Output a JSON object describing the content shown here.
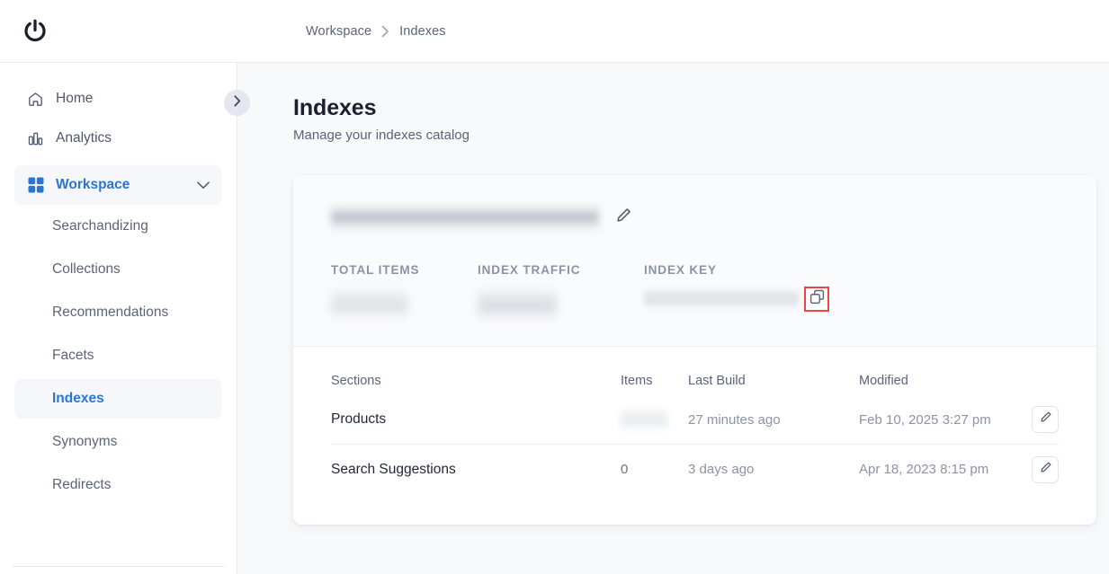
{
  "brand": {
    "logo_icon": "power-logo-icon"
  },
  "breadcrumb": {
    "items": [
      "Workspace",
      "Indexes"
    ],
    "separator": "›"
  },
  "sidebar": {
    "collapse_toggle_icon": "chevron-right-icon",
    "items": [
      {
        "label": "Home",
        "icon": "home-icon",
        "active": false
      },
      {
        "label": "Analytics",
        "icon": "bar-chart-icon",
        "active": false
      },
      {
        "label": "Workspace",
        "icon": "grid-icon",
        "active": true,
        "expanded": true,
        "chevron": "chevron-down-icon"
      }
    ],
    "sub_items": [
      {
        "label": "Searchandizing",
        "active": false
      },
      {
        "label": "Collections",
        "active": false
      },
      {
        "label": "Recommendations",
        "active": false
      },
      {
        "label": "Facets",
        "active": false
      },
      {
        "label": "Indexes",
        "active": true
      },
      {
        "label": "Synonyms",
        "active": false
      },
      {
        "label": "Redirects",
        "active": false
      }
    ]
  },
  "page": {
    "title": "Indexes",
    "subtitle": "Manage your indexes catalog"
  },
  "index_card": {
    "name_redacted": true,
    "name_value": "",
    "edit_name_icon": "pencil-icon",
    "stats": [
      {
        "key": "total_items",
        "label": "TOTAL ITEMS",
        "value": "",
        "redacted": true
      },
      {
        "key": "index_traffic",
        "label": "INDEX TRAFFIC",
        "value": "",
        "redacted": true
      },
      {
        "key": "index_key",
        "label": "INDEX KEY",
        "value": "",
        "redacted": true
      }
    ],
    "copy_key_icon": "copy-icon",
    "copy_highlight_color": "#ef4444"
  },
  "sections_table": {
    "columns": [
      "Sections",
      "Items",
      "Last Build",
      "Modified",
      ""
    ],
    "rows": [
      {
        "section": "Products",
        "items": "",
        "items_redacted": true,
        "last_build": "27 minutes ago",
        "modified": "Feb 10, 2025 3:27 pm",
        "edit_icon": "pencil-icon"
      },
      {
        "section": "Search Suggestions",
        "items": "0",
        "items_redacted": false,
        "last_build": "3 days ago",
        "modified": "Apr 18, 2023 8:15 pm",
        "edit_icon": "pencil-icon"
      }
    ]
  },
  "colors": {
    "accent": "#2b74d4",
    "page_bg": "#f7f9fb",
    "card_bg": "#ffffff",
    "card_top_bg": "#fafbfd",
    "highlight": "#ef4444",
    "text_primary": "#1b2030",
    "text_muted": "#8b93a4"
  }
}
